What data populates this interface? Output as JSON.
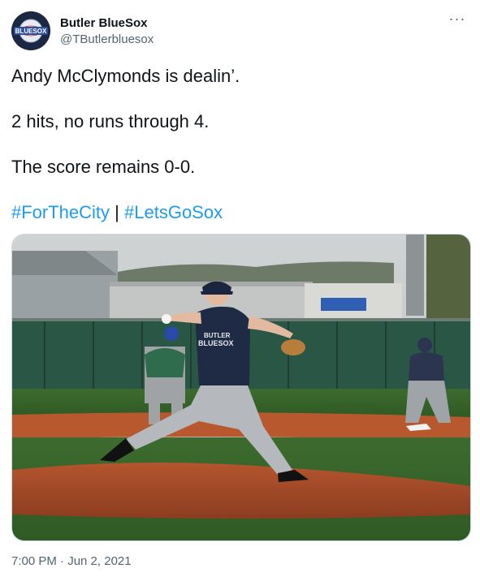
{
  "author": {
    "display_name": "Butler BlueSox",
    "handle": "@TButlerbluesox",
    "avatar_text": "BLUESOX"
  },
  "more_icon": "more-horizontal-icon",
  "tweet": {
    "line1": "Andy McClymonds is dealin’.",
    "line2": "2 hits, no runs through 4.",
    "line3": "The score remains 0-0.",
    "hashtag1": "#ForTheCity",
    "separator": "|",
    "hashtag2": "#LetsGoSox"
  },
  "media": {
    "jersey_text_top": "BUTLER",
    "jersey_text_bottom": "BLUESOX"
  },
  "timestamp": "7:00 PM · Jun 2, 2021",
  "colors": {
    "accent": "#1d9bf0",
    "text": "#0f1419",
    "secondary": "#536471"
  }
}
